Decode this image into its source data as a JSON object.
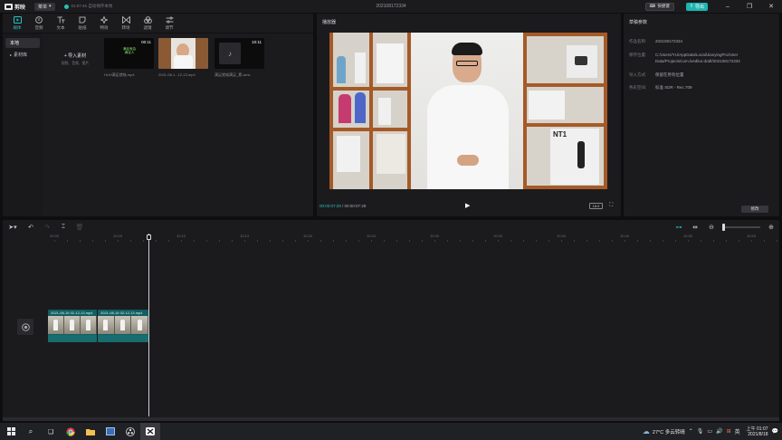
{
  "app": {
    "logo_text": "剪映",
    "menu_label": "菜单",
    "autosave": "01:07:46 自动保存本地",
    "doc_title": "202108172334",
    "shortcut_label": "快捷键",
    "export_label": "导出"
  },
  "tool_tabs": [
    {
      "label": "媒体",
      "icon": "media-icon"
    },
    {
      "label": "音频",
      "icon": "audio-icon"
    },
    {
      "label": "文本",
      "icon": "text-icon"
    },
    {
      "label": "贴纸",
      "icon": "sticker-icon"
    },
    {
      "label": "特效",
      "icon": "effects-icon"
    },
    {
      "label": "转场",
      "icon": "transition-icon"
    },
    {
      "label": "滤镜",
      "icon": "filter-icon"
    },
    {
      "label": "调节",
      "icon": "adjust-icon"
    }
  ],
  "media": {
    "side_items": [
      "本地",
      "素材库"
    ],
    "import_title": "导入素材",
    "import_sub": "视频、音频、图片",
    "clips": [
      {
        "name": "HUH满足就喵.mp4",
        "duration": "00:11",
        "overlay": "满足就会满足人"
      },
      {
        "name": "2021-08-1...12-13.mp4",
        "duration": ""
      },
      {
        "name": "满足就喵满足_素.wmv",
        "duration": "10:11"
      }
    ]
  },
  "player": {
    "title": "播放器",
    "current_time": "00:00:07:28",
    "total_time": "00:00:07:28",
    "ratio": "16:9",
    "video_card": "NT1"
  },
  "params": {
    "title": "草稿参数",
    "rows": [
      {
        "key": "作品名称:",
        "value": "202108172334"
      },
      {
        "key": "保存位置:",
        "value": "C:/Users/YU/AppData/Local/JianyingPro/User Data/Projects/com.lveditor.draft/202108172334"
      },
      {
        "key": "导入方式:",
        "value": "保留在原有位置"
      },
      {
        "key": "色彩空间:",
        "value": "标准 SDR - Rec.709"
      }
    ],
    "modify_label": "修改"
  },
  "timeline": {
    "ticks": [
      "00:00",
      "10:03",
      "10:10",
      "10:13",
      "10:20",
      "10:23",
      "10:30",
      "10:33",
      "10:40",
      "10:43",
      "10:50",
      "10:53"
    ],
    "clips": [
      {
        "label": "2021-08-16 02-12-13.mp4"
      },
      {
        "label": "2021-08-16 02-12-13.mp4"
      }
    ]
  },
  "taskbar": {
    "weather": "27°C 多云转晴",
    "ime": "英",
    "time": "上午 01:07",
    "date": "2021/8/18"
  },
  "colors": {
    "accent": "#1fb5b0",
    "panel": "#1b1b1e"
  }
}
